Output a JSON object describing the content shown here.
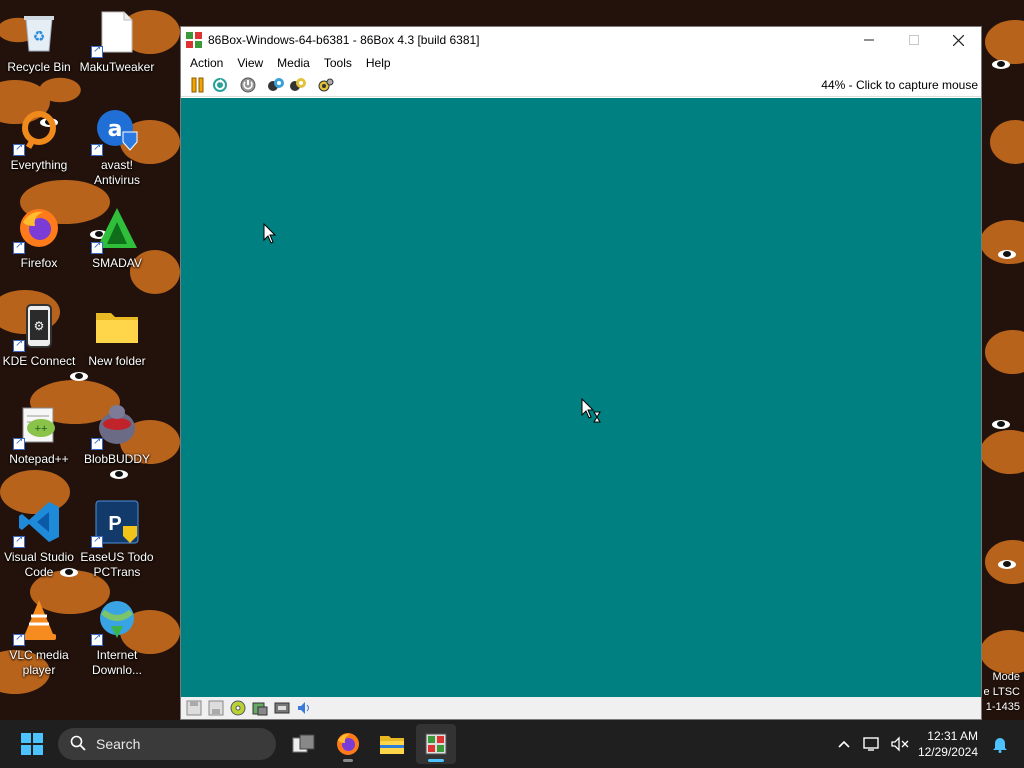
{
  "desktop": {
    "icons": [
      {
        "label": "Recycle Bin"
      },
      {
        "label": "MakuTweaker"
      },
      {
        "label": "Everything"
      },
      {
        "label": "avast!\nAntivirus"
      },
      {
        "label": "Firefox"
      },
      {
        "label": "SMADAV"
      },
      {
        "label": "KDE Connect"
      },
      {
        "label": "New folder"
      },
      {
        "label": "Notepad++"
      },
      {
        "label": "BlobBUDDY"
      },
      {
        "label": "Visual Studio\nCode"
      },
      {
        "label": "EaseUS Todo\nPCTrans"
      },
      {
        "label": "VLC media\nplayer"
      },
      {
        "label": "Internet\nDownlo..."
      }
    ],
    "watermark_lines": [
      "Mode",
      "e LTSC",
      "1-1435"
    ]
  },
  "window": {
    "title": "86Box-Windows-64-b6381 - 86Box 4.3 [build 6381]",
    "menu": [
      "Action",
      "View",
      "Media",
      "Tools",
      "Help"
    ],
    "status_right": "44% - Click to capture mouse",
    "screen_color": "#008080"
  },
  "taskbar": {
    "search_placeholder": "Search",
    "time": "12:31 AM",
    "date": "12/29/2024"
  },
  "colors": {
    "accent": "#4cc2ff",
    "emulator_screen": "#008080",
    "taskbar": "#1f1f1f"
  }
}
